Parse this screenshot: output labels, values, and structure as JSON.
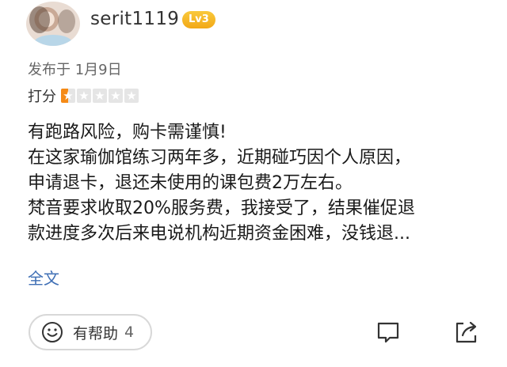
{
  "user": {
    "name": "serit1119",
    "level": "Lv3"
  },
  "review": {
    "published": "发布于 1月9日",
    "rating_label": "打分",
    "rating": 0.5,
    "rating_max": 5,
    "lines": [
      "有跑路风险，购卡需谨慎!",
      "在这家瑜伽馆练习两年多，近期碰巧因个人原因，",
      "申请退卡，退还未使用的课包费2万左右。",
      "梵音要求收取20%服务费，我接受了，结果催促退",
      "款进度多次后来电说机构近期资金困难，没钱退..."
    ],
    "full_text_link": "全文"
  },
  "actions": {
    "helpful_label": "有帮助",
    "helpful_count": "4",
    "comment_icon": "comment-icon",
    "share_icon": "share-icon"
  },
  "colors": {
    "accent_link": "#3f6fb5",
    "star_active": "#f58a16",
    "star_inactive": "#e5e5e5",
    "level_badge": "#f2a816"
  }
}
